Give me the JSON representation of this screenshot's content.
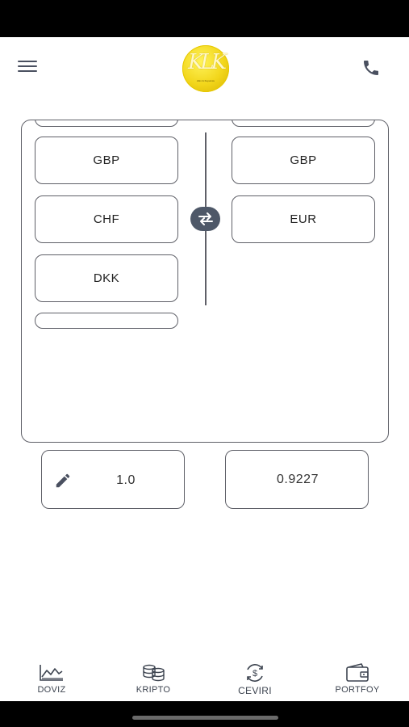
{
  "header": {
    "logo_text": "KLK",
    "logo_subtext": "Altın & Kuyumcu"
  },
  "converter": {
    "from_list": [
      "GBP",
      "CHF",
      "DKK"
    ],
    "to_list": [
      "GBP",
      "EUR"
    ],
    "amount": "1.0",
    "result": "0.9227"
  },
  "nav": {
    "items": [
      {
        "label": "DOVIZ",
        "icon": "chart-icon"
      },
      {
        "label": "KRIPTO",
        "icon": "coins-icon"
      },
      {
        "label": "CEVIRI",
        "icon": "exchange-icon"
      },
      {
        "label": "PORTFOY",
        "icon": "wallet-icon"
      }
    ]
  },
  "colors": {
    "border": "#5f6068",
    "swap_button": "#4e5868",
    "logo_gold": "#f2d61b"
  }
}
